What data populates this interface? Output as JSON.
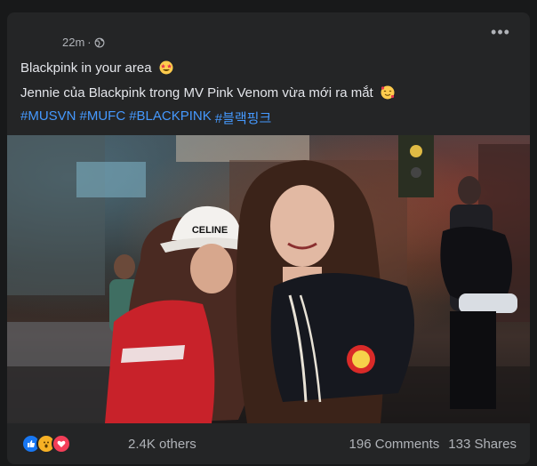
{
  "post": {
    "time": "22m",
    "privacy_icon": "globe-icon",
    "more_icon": "more-options-icon",
    "line1": "Blackpink in your area",
    "line1_emoji": "star-struck-emoji",
    "line2": "Jennie của Blackpink trong MV Pink Venom vừa mới ra mắt",
    "line2_emoji": "smiling-face-with-hearts-emoji",
    "hashtags": [
      "#MUSVN",
      "#MUFC",
      "#BLACKPINK",
      "#블랙핑크"
    ]
  },
  "stats": {
    "reaction_icons": [
      "like-icon",
      "wow-icon",
      "love-icon"
    ],
    "reactions_text": "2.4K others",
    "comments": "196 Comments",
    "shares": "133 Shares"
  },
  "image": {
    "sign_text": "CELINE"
  },
  "colors": {
    "background": "#18191a",
    "card": "#242526",
    "text": "#e4e6eb",
    "secondary": "#b0b3b8",
    "link": "#4599ff"
  }
}
